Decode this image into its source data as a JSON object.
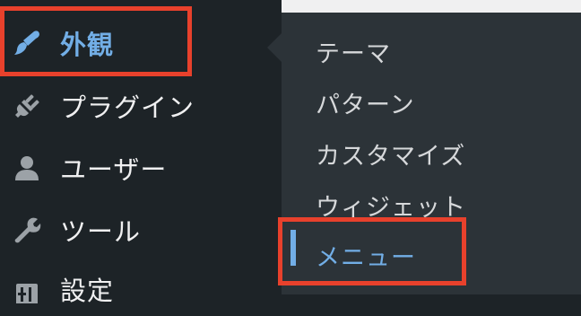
{
  "sidebar": {
    "items": [
      {
        "label": "外観",
        "icon": "paintbrush-icon",
        "current": true
      },
      {
        "label": "プラグイン",
        "icon": "plugin-icon"
      },
      {
        "label": "ユーザー",
        "icon": "user-icon"
      },
      {
        "label": "ツール",
        "icon": "wrench-icon"
      },
      {
        "label": "設定",
        "icon": "settings-icon"
      }
    ]
  },
  "submenu": {
    "items": [
      {
        "label": "テーマ"
      },
      {
        "label": "パターン"
      },
      {
        "label": "カスタマイズ"
      },
      {
        "label": "ウィジェット"
      },
      {
        "label": "メニュー",
        "current": true
      }
    ]
  },
  "colors": {
    "sidebar_bg": "#1d2327",
    "submenu_bg": "#2c3338",
    "accent": "#72aee6",
    "highlight": "#e8412c"
  }
}
